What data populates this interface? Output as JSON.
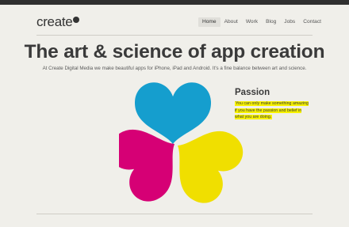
{
  "brand": {
    "logo_text": "create"
  },
  "nav": {
    "items": [
      {
        "label": "Home",
        "active": true
      },
      {
        "label": "About",
        "active": false
      },
      {
        "label": "Work",
        "active": false
      },
      {
        "label": "Blog",
        "active": false
      },
      {
        "label": "Jobs",
        "active": false
      },
      {
        "label": "Contact",
        "active": false
      }
    ]
  },
  "hero": {
    "headline": "The art & science of app creation",
    "subline": "At Create Digital Media we make beautiful apps for iPhone, iPad and Android. It's a fine balance between art and science."
  },
  "feature": {
    "title": "Passion",
    "text": "You can only make something amazing if you have the passion and belief in what you are doing."
  },
  "colors": {
    "background": "#f0efea",
    "cyan": "#16a9e1",
    "magenta": "#e4007f",
    "yellow": "#ffee00",
    "highlight": "#f7f200"
  }
}
